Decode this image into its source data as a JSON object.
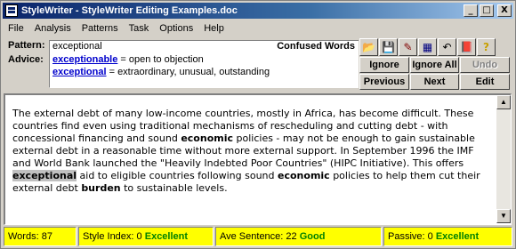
{
  "window": {
    "title": "StyleWriter - StyleWriter Editing Examples.doc"
  },
  "titlebar": {
    "minimize": "_",
    "maximize": "□",
    "close": "X"
  },
  "menu": [
    "File",
    "Analysis",
    "Patterns",
    "Task",
    "Options",
    "Help"
  ],
  "pattern": {
    "label": "Pattern:",
    "value": "exceptional",
    "category": "Confused Words"
  },
  "advice": {
    "label": "Advice:",
    "items": [
      {
        "word": "exceptionable",
        "meaning": " = open to objection"
      },
      {
        "word": "exceptional",
        "meaning": " = extraordinary, unusual, outstanding"
      }
    ]
  },
  "toolbar": {
    "icons": [
      "open-folder-icon",
      "save-icon",
      "edit-icon",
      "grid-icon",
      "undo-icon",
      "book-icon",
      "help-icon"
    ],
    "glyphs": [
      "📂",
      "💾",
      "✎",
      "▦",
      "↶",
      "📕",
      "?"
    ]
  },
  "buttons": {
    "ignore": "Ignore",
    "ignore_all": "Ignore All",
    "undo": "Undo",
    "previous": "Previous",
    "next": "Next",
    "edit": "Edit"
  },
  "document": {
    "segments": [
      {
        "t": "The external debt of many low-income countries, mostly in Africa, has become difficult. These countries find even using traditional mechanisms of rescheduling and cutting debt  - with concessional financing and sound ",
        "s": ""
      },
      {
        "t": "economic",
        "s": "b"
      },
      {
        "t": " policies - may not be enough to gain sustainable external debt in a reasonable time without more external support.  In September 1996 the IMF and World Bank launched the \"Heavily Indebted Poor Countries\" (HIPC Initiative).  This offers ",
        "s": ""
      },
      {
        "t": "exceptional",
        "s": "hl"
      },
      {
        "t": " aid to eligible countries following sound ",
        "s": ""
      },
      {
        "t": "economic",
        "s": "b"
      },
      {
        "t": " policies to help them cut their external debt ",
        "s": ""
      },
      {
        "t": "burden",
        "s": "b"
      },
      {
        "t": " to sustainable levels.",
        "s": ""
      }
    ]
  },
  "status": {
    "words_label": "Words: ",
    "words": "87",
    "style_label": "Style Index: ",
    "style_value": "0",
    "style_rating": "Excellent",
    "sentence_label": "Ave Sentence: ",
    "sentence_value": "22",
    "sentence_rating": "Good",
    "passive_label": "Passive: ",
    "passive_value": "0",
    "passive_rating": "Excellent"
  },
  "colors": {
    "status_bg": "#ffff00",
    "rating_good": "#008000",
    "link": "#0000cc",
    "title_bar": "#0a246a"
  }
}
